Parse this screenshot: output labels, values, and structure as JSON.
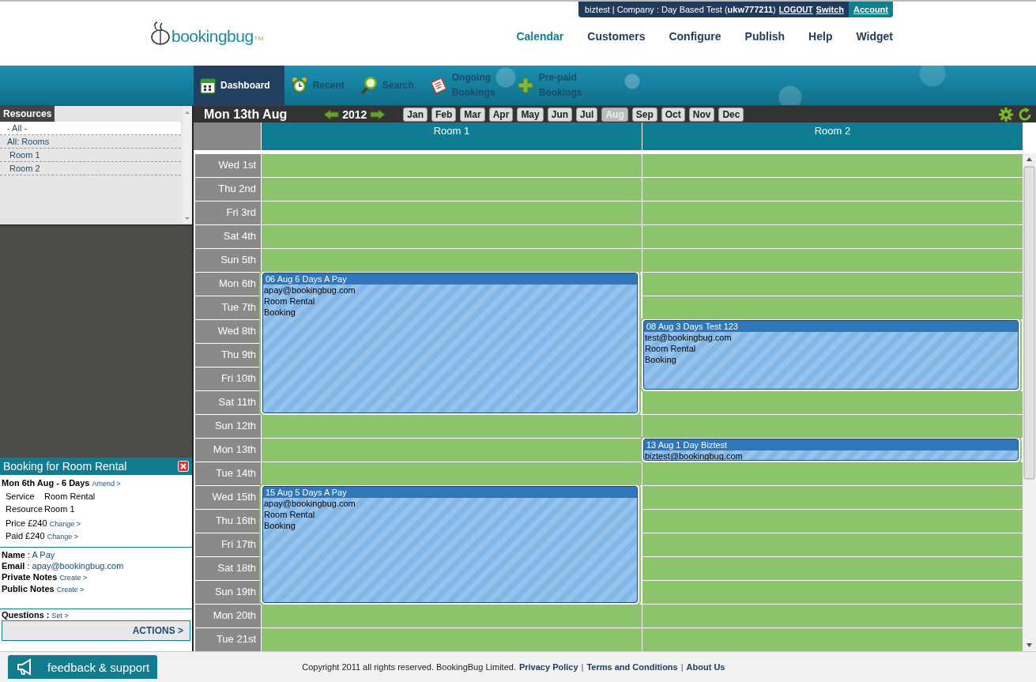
{
  "header": {
    "logo": "bookingbug",
    "logo_mark": "TM",
    "account_bar": {
      "user": "biztest | Company : Day Based Test (**ukw777211**)",
      "links": [
        "LOGOUT",
        "Switch"
      ],
      "account": "Account"
    },
    "nav": [
      {
        "label": "Calendar",
        "selected": true
      },
      {
        "label": "Customers",
        "selected": false
      },
      {
        "label": "Configure",
        "selected": false
      },
      {
        "label": "Publish",
        "selected": false
      },
      {
        "label": "Help",
        "selected": false
      },
      {
        "label": "Widget",
        "selected": false
      }
    ]
  },
  "tabs": [
    {
      "kind": "calendar",
      "label": "Dashboard",
      "selected": true
    },
    {
      "kind": "clock",
      "label": "Recent",
      "selected": false
    },
    {
      "kind": "search",
      "label": "Search",
      "selected": false
    },
    {
      "kind": "ledger",
      "label": "Ongoing Bookings",
      "selected": false
    },
    {
      "kind": "plus",
      "label": "Pre-paid Bookings",
      "selected": false
    }
  ],
  "resources": {
    "title": "Resources",
    "items": [
      {
        "label": "- All -",
        "selected": true
      },
      {
        "label": "All: Rooms",
        "selected": false
      },
      {
        "label": "Room 1",
        "selected": false
      },
      {
        "label": "Room 2",
        "selected": false
      }
    ]
  },
  "booking_panel": {
    "title": "Booking for Room Rental",
    "when": "Mon 6th Aug - 6 Days",
    "amend": "Amend >",
    "details": [
      {
        "label": "Service",
        "value": "Room Rental"
      },
      {
        "label": "Resource",
        "value": "Room 1"
      }
    ],
    "payments": [
      {
        "label": "Price",
        "value": "£240",
        "link": "Change >"
      },
      {
        "label": "Paid",
        "value": "£240",
        "link": "Change >"
      }
    ],
    "customer": [
      {
        "label": "Name",
        "separator": ":",
        "value": "A Pay"
      },
      {
        "label": "Email",
        "separator": ":",
        "value": "apay@bookingbug.com"
      }
    ],
    "notes": [
      {
        "label": "Private Notes",
        "link": "Create >"
      },
      {
        "label": "Public Notes",
        "link": "Create >"
      }
    ],
    "questions": {
      "label": "Questions :",
      "link": "Set >"
    },
    "actions": "ACTIONS >"
  },
  "calendar": {
    "date": "Mon 13th Aug",
    "year": "2012",
    "months": [
      {
        "label": "Jan",
        "selected": false
      },
      {
        "label": "Feb",
        "selected": false
      },
      {
        "label": "Mar",
        "selected": false
      },
      {
        "label": "Apr",
        "selected": false
      },
      {
        "label": "May",
        "selected": false
      },
      {
        "label": "Jun",
        "selected": false
      },
      {
        "label": "Jul",
        "selected": false
      },
      {
        "label": "Aug",
        "selected": true
      },
      {
        "label": "Sep",
        "selected": false
      },
      {
        "label": "Oct",
        "selected": false
      },
      {
        "label": "Nov",
        "selected": false
      },
      {
        "label": "Dec",
        "selected": false
      }
    ],
    "rooms": [
      "Room 1",
      "Room 2"
    ],
    "days": [
      {
        "label": "Wed 1st",
        "slots": [
          {
            "booked": false
          },
          {
            "booked": false
          }
        ]
      },
      {
        "label": "Thu 2nd",
        "slots": [
          {
            "booked": false
          },
          {
            "booked": false
          }
        ]
      },
      {
        "label": "Fri 3rd",
        "slots": [
          {
            "booked": false
          },
          {
            "booked": false
          }
        ]
      },
      {
        "label": "Sat 4th",
        "slots": [
          {
            "booked": false
          },
          {
            "booked": false
          }
        ]
      },
      {
        "label": "Sun 5th",
        "slots": [
          {
            "booked": false
          },
          {
            "booked": false
          }
        ]
      },
      {
        "label": "Mon 6th",
        "slots": [
          {
            "booked": true,
            "booking": {
              "title": "06 Aug 6 Days A Pay",
              "lines": [
                "apay@bookingbug.com",
                "Room Rental",
                "Booking"
              ]
            }
          },
          {
            "booked": false
          }
        ]
      },
      {
        "label": "Tue 7th",
        "slots": [
          {
            "booked": true
          },
          {
            "booked": false
          }
        ]
      },
      {
        "label": "Wed 8th",
        "slots": [
          {
            "booked": true
          },
          {
            "booked": true,
            "booking": {
              "title": "08 Aug 3 Days Test 123",
              "lines": [
                "test@bookingbug.com",
                "Room Rental",
                "Booking"
              ]
            }
          }
        ]
      },
      {
        "label": "Thu 9th",
        "slots": [
          {
            "booked": true
          },
          {
            "booked": true
          }
        ]
      },
      {
        "label": "Fri 10th",
        "slots": [
          {
            "booked": true
          },
          {
            "booked": true
          }
        ]
      },
      {
        "label": "Sat 11th",
        "slots": [
          {
            "booked": true
          },
          {
            "booked": false
          }
        ]
      },
      {
        "label": "Sun 12th",
        "slots": [
          {
            "booked": false
          },
          {
            "booked": false
          }
        ]
      },
      {
        "label": "Mon 13th",
        "slots": [
          {
            "booked": false
          },
          {
            "booked": true,
            "booking": {
              "title": "13 Aug 1 Day Biztest",
              "lines": [
                "biztest@bookingbug.com"
              ]
            }
          }
        ]
      },
      {
        "label": "Tue 14th",
        "slots": [
          {
            "booked": false
          },
          {
            "booked": false
          }
        ]
      },
      {
        "label": "Wed 15th",
        "slots": [
          {
            "booked": true,
            "booking": {
              "title": "15 Aug 5 Days A Pay",
              "lines": [
                "apay@bookingbug.com",
                "Room Rental",
                "Booking"
              ]
            }
          },
          {
            "booked": false
          }
        ]
      },
      {
        "label": "Thu 16th",
        "slots": [
          {
            "booked": true
          },
          {
            "booked": false
          }
        ]
      },
      {
        "label": "Fri 17th",
        "slots": [
          {
            "booked": true
          },
          {
            "booked": false
          }
        ]
      },
      {
        "label": "Sat 18th",
        "slots": [
          {
            "booked": true
          },
          {
            "booked": false
          }
        ]
      },
      {
        "label": "Sun 19th",
        "slots": [
          {
            "booked": true
          },
          {
            "booked": false
          }
        ]
      },
      {
        "label": "Mon 20th",
        "slots": [
          {
            "booked": false
          },
          {
            "booked": false
          }
        ]
      },
      {
        "label": "Tue 21st",
        "slots": [
          {
            "booked": false
          },
          {
            "booked": false
          }
        ]
      }
    ]
  },
  "footer": {
    "feedback": "feedback & support",
    "copyright": "Copyright 2011 all rights reserved. BookingBug Limited.",
    "separator": "|",
    "links": [
      "Privacy Policy",
      "Terms and Conditions",
      "About Us"
    ]
  }
}
